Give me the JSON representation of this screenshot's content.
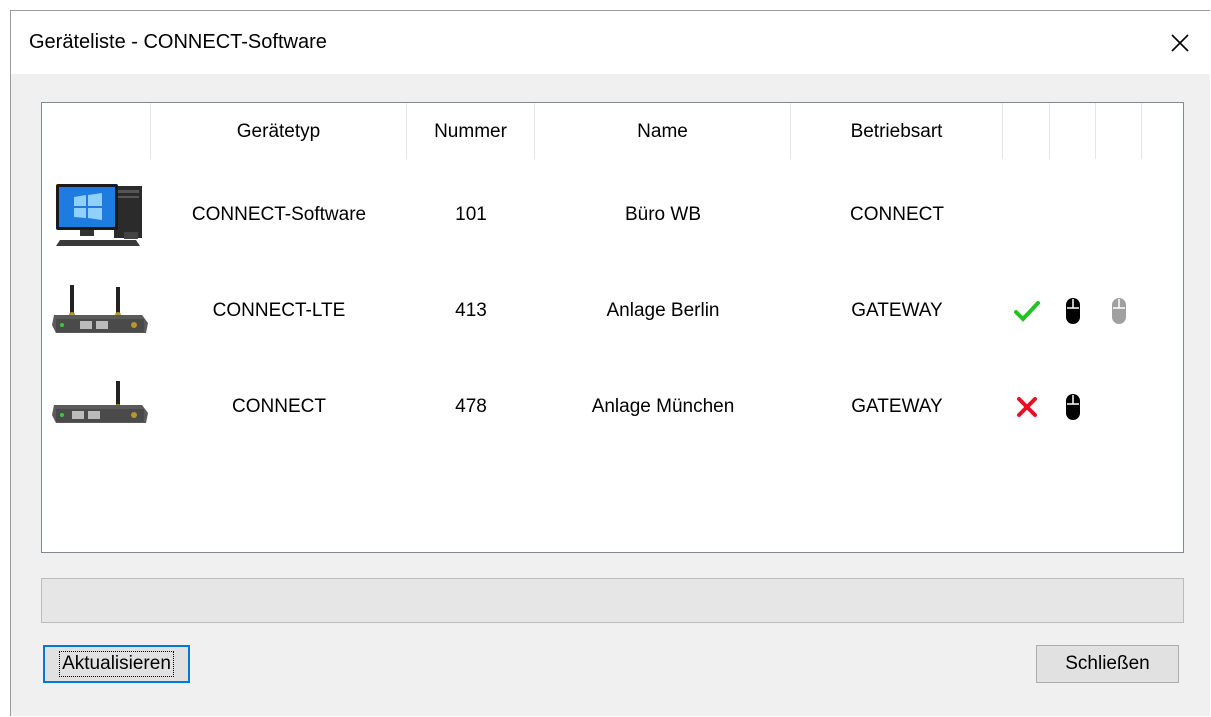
{
  "window": {
    "title": "Geräteliste - CONNECT-Software"
  },
  "list": {
    "columns": [
      "Gerätetyp",
      "Nummer",
      "Name",
      "Betriebsart"
    ],
    "rows": [
      {
        "icon": "desktop-computer-icon",
        "typ": "CONNECT-Software",
        "nummer": "101",
        "name": "Büro WB",
        "betriebsart": "CONNECT",
        "status": []
      },
      {
        "icon": "lte-router-icon",
        "typ": "CONNECT-LTE",
        "nummer": "413",
        "name": "Anlage Berlin",
        "betriebsart": "GATEWAY",
        "status": [
          "check-icon",
          "mouse-icon",
          "mouse-disabled-icon"
        ]
      },
      {
        "icon": "router-icon",
        "typ": "CONNECT",
        "nummer": "478",
        "name": "Anlage München",
        "betriebsart": "GATEWAY",
        "status": [
          "cross-icon",
          "mouse-icon"
        ]
      }
    ]
  },
  "progress": {
    "value": 0
  },
  "buttons": {
    "refresh": "Aktualisieren",
    "close": "Schließen"
  },
  "colors": {
    "check": "#22c322",
    "cross": "#e81123",
    "mouse": "#000000",
    "mouse_disabled": "#a0a0a0"
  }
}
